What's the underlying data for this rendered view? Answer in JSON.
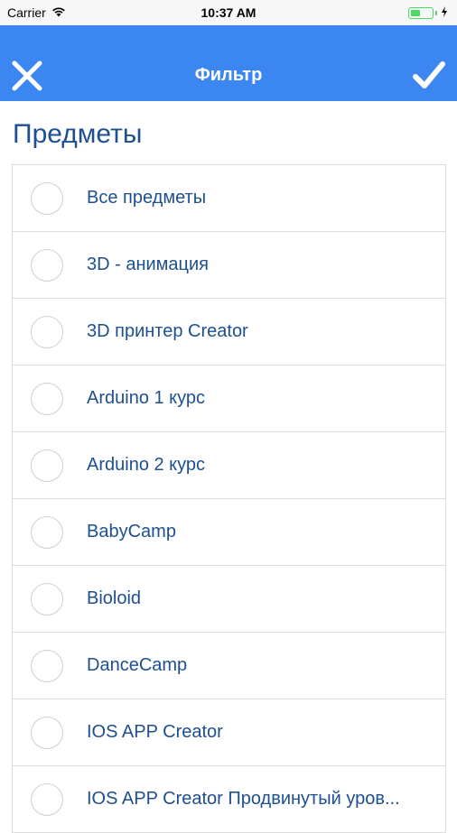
{
  "status_bar": {
    "carrier": "Carrier",
    "time": "10:37 AM"
  },
  "nav": {
    "title": "Фильтр",
    "close_icon": "close-icon",
    "done_icon": "checkmark-icon",
    "background_color": "#3c86f2"
  },
  "section": {
    "title": "Предметы"
  },
  "items": [
    {
      "label": "Все предметы",
      "selected": false
    },
    {
      "label": "3D - анимация",
      "selected": false
    },
    {
      "label": "3D принтер Creator",
      "selected": false
    },
    {
      "label": "Arduino 1 курс",
      "selected": false
    },
    {
      "label": "Arduino 2 курс",
      "selected": false
    },
    {
      "label": "BabyCamp",
      "selected": false
    },
    {
      "label": "Bioloid",
      "selected": false
    },
    {
      "label": "DanceCamp",
      "selected": false
    },
    {
      "label": "IOS APP Creator",
      "selected": false
    },
    {
      "label": "IOS APP Creator Продвинутый уров...",
      "selected": false
    }
  ],
  "colors": {
    "accent": "#3c86f2",
    "text": "#1d4f91",
    "battery": "#4cd964"
  }
}
